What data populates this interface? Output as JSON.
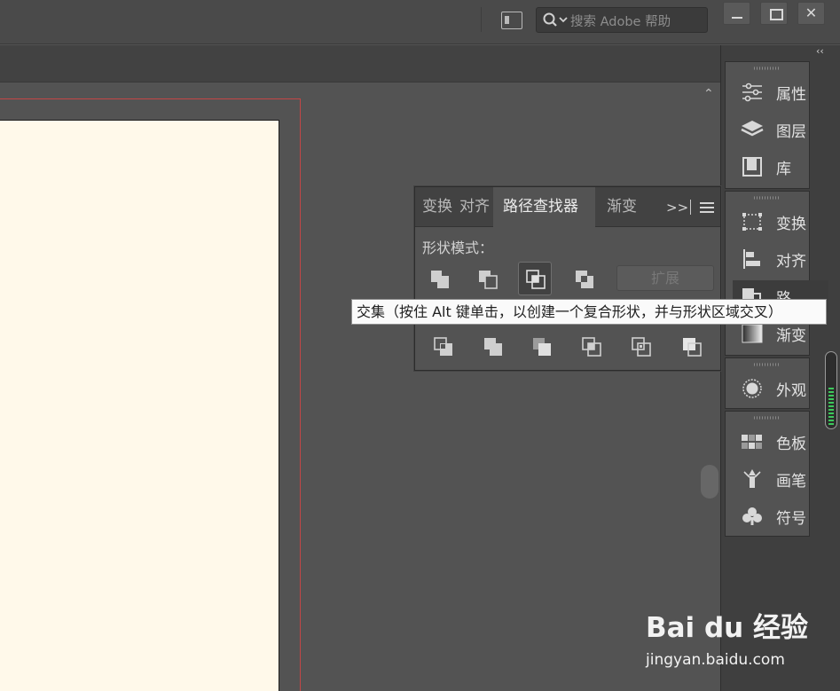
{
  "topbar": {
    "search_placeholder": "搜索 Adobe 帮助",
    "window_buttons": {
      "minimize": "minimize-icon",
      "maximize": "maximize-icon",
      "close": "✕"
    }
  },
  "dock": {
    "collapse": "‹‹",
    "items": [
      {
        "label": "属性",
        "icon": "properties-icon"
      },
      {
        "label": "图层",
        "icon": "layers-icon"
      },
      {
        "label": "库",
        "icon": "libraries-icon"
      },
      {
        "label": "变换",
        "icon": "transform-icon"
      },
      {
        "label": "对齐",
        "icon": "align-icon"
      },
      {
        "label": "路",
        "icon": "pathfinder-icon"
      },
      {
        "label": "渐变",
        "icon": "gradient-icon"
      },
      {
        "label": "外观",
        "icon": "appearance-icon"
      },
      {
        "label": "色板",
        "icon": "swatches-icon"
      },
      {
        "label": "画笔",
        "icon": "brushes-icon"
      },
      {
        "label": "符号",
        "icon": "symbols-icon"
      }
    ]
  },
  "pathfinder": {
    "tabs": [
      {
        "label": "变换"
      },
      {
        "label": "对齐"
      },
      {
        "label": "路径查找器",
        "active": true
      },
      {
        "label": "渐变"
      }
    ],
    "more": ">>",
    "shape_modes_label": "形状模式：",
    "expand_label": "扩展",
    "shape_mode_buttons": [
      "unite-icon",
      "minus-front-icon",
      "intersect-icon",
      "exclude-icon"
    ],
    "pathfinder_buttons": [
      "divide-icon",
      "trim-icon",
      "merge-icon",
      "crop-icon",
      "outline-icon",
      "minus-back-icon"
    ]
  },
  "tooltip": {
    "text": "交集（按住 Alt 键单击，以创建一个复合形状，并与形状区域交叉）"
  },
  "watermark": {
    "logo": "Bai du 经验",
    "url": "jingyan.baidu.com"
  },
  "scroll": {
    "up": "⌃"
  }
}
